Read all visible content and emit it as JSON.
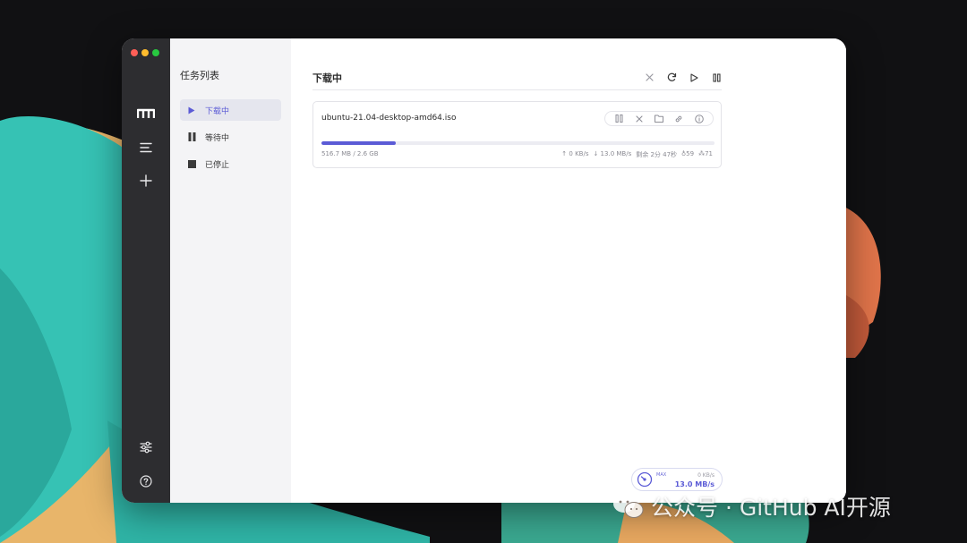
{
  "colors": {
    "accent": "#5b5bd6",
    "rail": "#2d2d30",
    "sidebar": "#f4f4f6",
    "traffic_red": "#ff5f57",
    "traffic_yellow": "#febc2e",
    "traffic_green": "#28c840"
  },
  "rail": {
    "icons": [
      "motrix-logo-icon",
      "menu-icon",
      "plus-icon",
      "settings-sliders-icon",
      "help-icon"
    ]
  },
  "sidebar": {
    "title": "任务列表",
    "items": [
      {
        "label": "下载中",
        "icon": "play-icon",
        "active": true
      },
      {
        "label": "等待中",
        "icon": "pause-icon",
        "active": false
      },
      {
        "label": "已停止",
        "icon": "stop-icon",
        "active": false
      }
    ]
  },
  "main": {
    "title": "下载中",
    "actions": [
      "close-icon",
      "refresh-icon",
      "play-icon",
      "pause-icon"
    ]
  },
  "task": {
    "name": "ubuntu-21.04-desktop-amd64.iso",
    "progress": 0.19,
    "size": "516.7 MB / 2.6 GB",
    "upload": "↑ 0 KB/s",
    "download": "↓ 13.0 MB/s",
    "remaining": "剩余 2分 47秒",
    "seeders": "♁59",
    "peers": "⁂71",
    "actions": [
      "pause-icon",
      "delete-icon",
      "folder-icon",
      "link-icon",
      "info-icon"
    ]
  },
  "speed_widget": {
    "label": "MAX",
    "upload": "0 KB/s",
    "download": "13.0 MB/s"
  },
  "watermark": {
    "text": "公众号 · GitHub AI开源"
  }
}
